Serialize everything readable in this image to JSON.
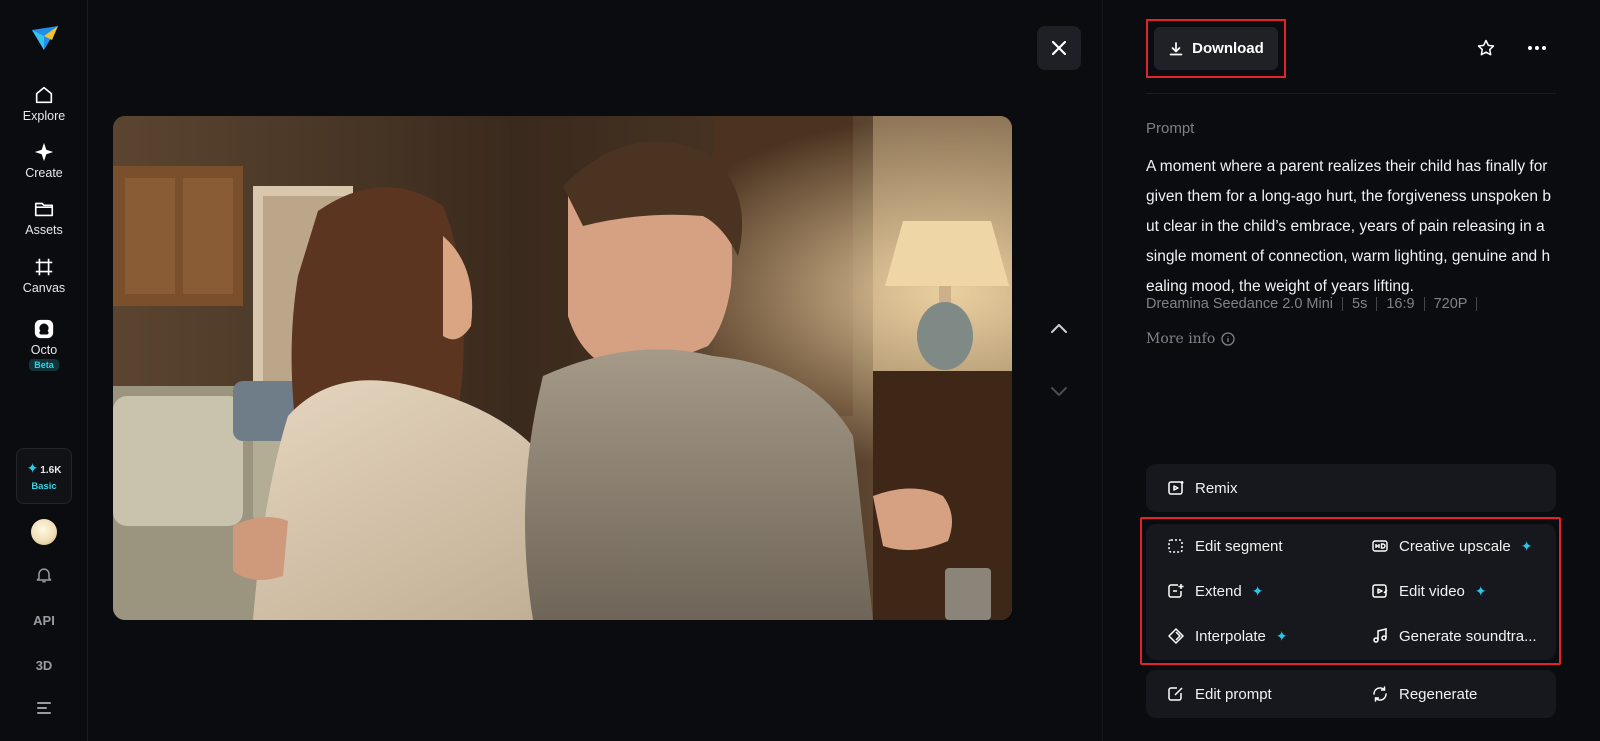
{
  "sidebar": {
    "items": [
      {
        "label": "Explore",
        "icon": "home-icon"
      },
      {
        "label": "Create",
        "icon": "sparkle-icon"
      },
      {
        "label": "Assets",
        "icon": "folder-icon"
      },
      {
        "label": "Canvas",
        "icon": "canvas-icon"
      },
      {
        "label": "Octo",
        "icon": "octo-icon",
        "badge": "Beta"
      }
    ],
    "credits": {
      "amount": "1.6K",
      "plan": "Basic"
    },
    "bottom": {
      "api_label": "API",
      "threed_label": "3D"
    }
  },
  "viewer": {
    "description": "Video frame: a man and young woman embrace in a warmly lit living room"
  },
  "panel": {
    "download_label": "Download",
    "prompt_heading": "Prompt",
    "prompt_text": "A moment where a parent realizes their child has finally forgiven them for a long-ago hurt, the forgiveness unspoken but clear in the child’s embrace, years of pain releasing in a single moment of connection, warm lighting, genuine and healing mood, the weight of years lifting.",
    "meta": {
      "model": "Dreamina Seedance 2.0 Mini",
      "duration": "5s",
      "ratio": "16:9",
      "resolution": "720P"
    },
    "more_info_label": "More info",
    "actions": {
      "remix": "Remix",
      "edit_segment": "Edit segment",
      "creative_upscale": "Creative upscale",
      "extend": "Extend",
      "edit_video": "Edit video",
      "interpolate": "Interpolate",
      "generate_soundtrack": "Generate soundtra...",
      "edit_prompt": "Edit prompt",
      "regenerate": "Regenerate"
    }
  },
  "colors": {
    "background": "#0b0c10",
    "card": "#17181d",
    "accent_cyan": "#29c6ea",
    "highlight_red": "#e0242a"
  }
}
